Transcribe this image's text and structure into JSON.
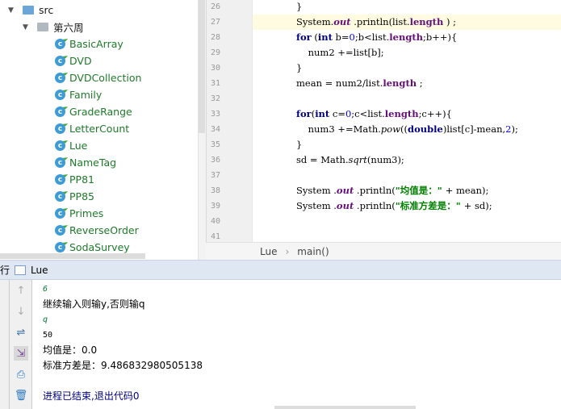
{
  "tree": {
    "src": "src",
    "package": "第六周",
    "classes": [
      "BasicArray",
      "DVD",
      "DVDCollection",
      "Family",
      "GradeRange",
      "LetterCount",
      "Lue",
      "NameTag",
      "PP81",
      "PP85",
      "Primes",
      "ReverseOrder",
      "SodaSurvey"
    ]
  },
  "editor": {
    "line_numbers": [
      "26",
      "27",
      "28",
      "29",
      "30",
      "31",
      "32",
      "33",
      "34",
      "35",
      "36",
      "37",
      "38",
      "39",
      "40",
      "41"
    ]
  },
  "breadcrumb": {
    "class": "Lue",
    "method": "main()"
  },
  "run": {
    "label": "行",
    "tab": "Lue"
  },
  "console": {
    "lines": [
      "6",
      "继续输入则输y,否则输q",
      "q",
      "50",
      "均值是：0.0",
      "标准方差是：9.486832980505138",
      "",
      "进程已结束,退出代码0"
    ]
  }
}
